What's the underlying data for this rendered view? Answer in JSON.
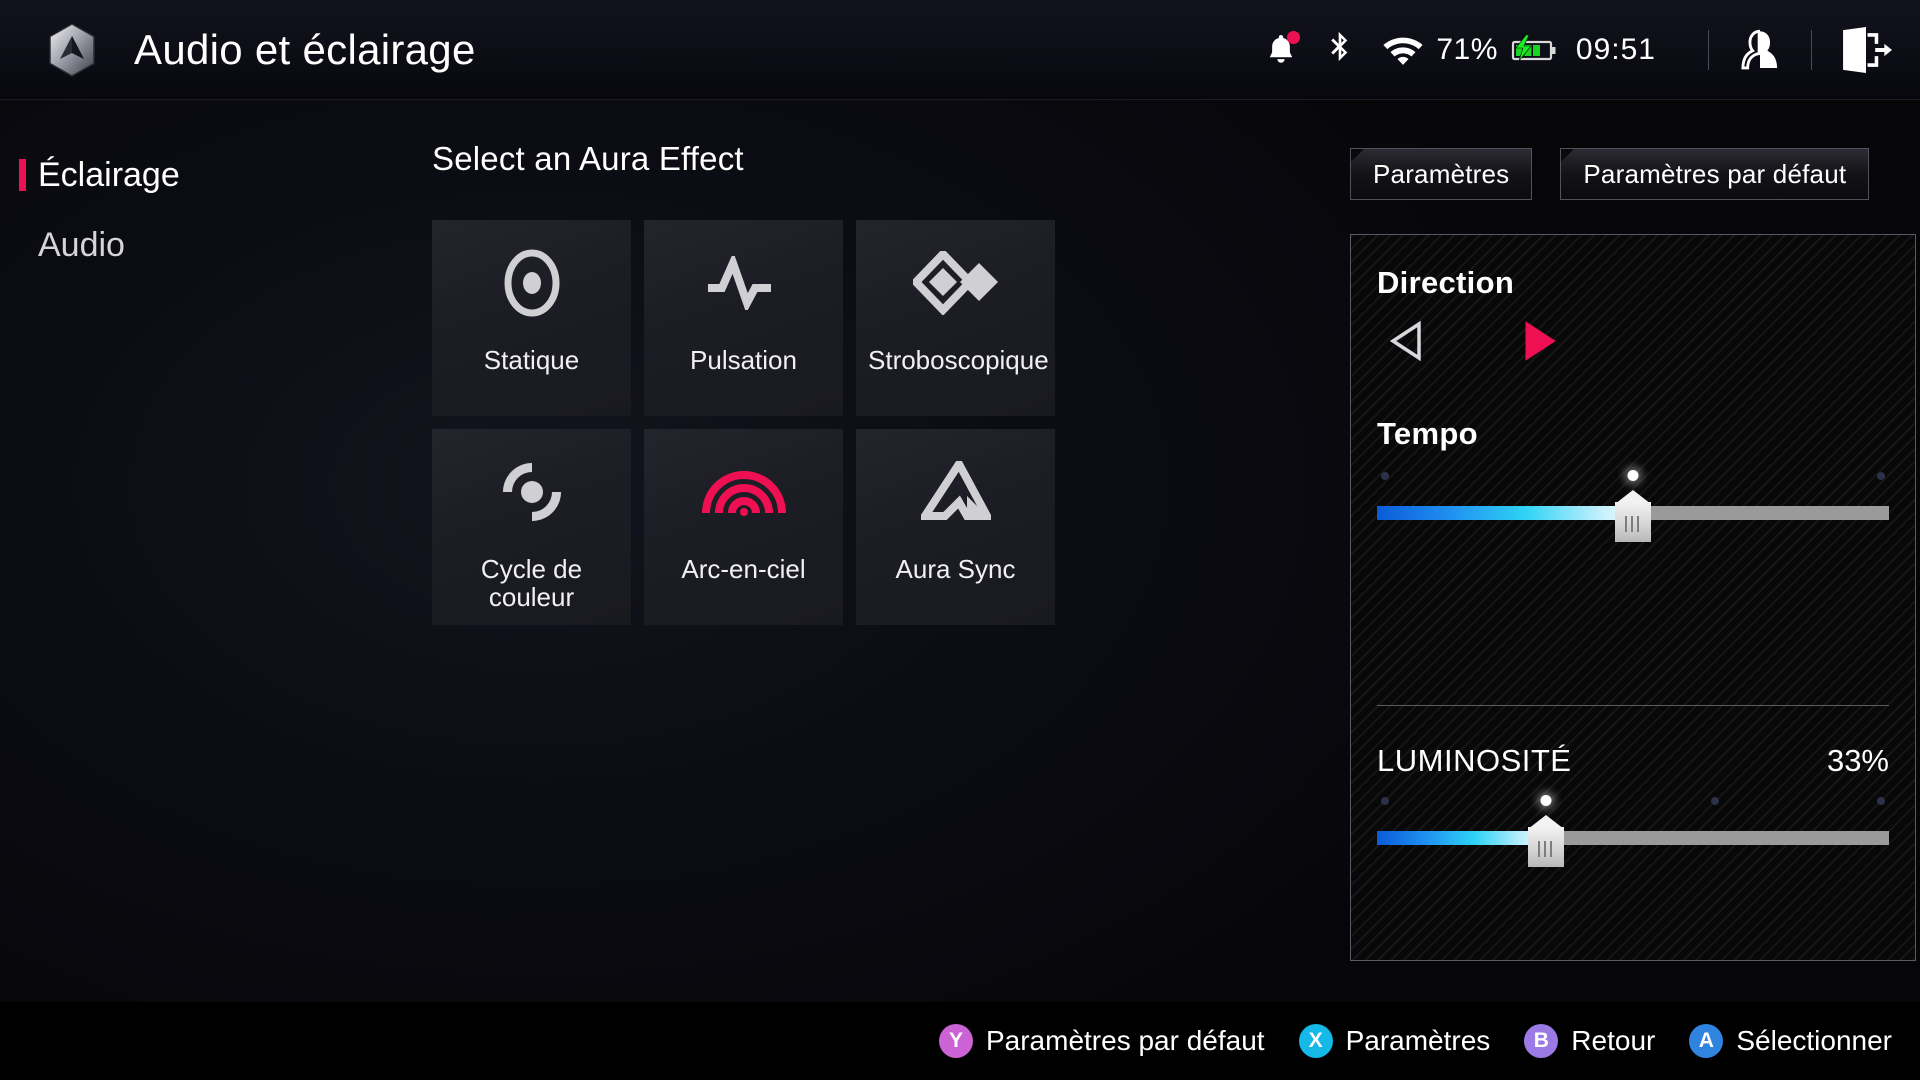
{
  "header": {
    "logo_icon": "asus-rog-hex-logo-icon",
    "title": "Audio et éclairage",
    "status": {
      "notification_icon": "bell-icon",
      "notification_has_badge": true,
      "bluetooth_icon": "bluetooth-icon",
      "wifi_icon": "wifi-icon",
      "battery_percent": "71%",
      "battery_icon": "battery-charging-icon",
      "clock": "09:51",
      "user_icon": "user-profile-icon",
      "exit_icon": "exit-logout-icon"
    }
  },
  "sidebar": {
    "items": [
      {
        "label": "Éclairage",
        "active": true
      },
      {
        "label": "Audio",
        "active": false
      }
    ]
  },
  "main": {
    "section_title": "Select an Aura Effect",
    "effects": [
      {
        "label": "Statique",
        "icon": "static-ring-dot-icon",
        "accent": "#cfcfd4",
        "selected": false
      },
      {
        "label": "Pulsation",
        "icon": "pulse-waveform-icon",
        "accent": "#cfcfd4",
        "selected": false
      },
      {
        "label": "Stroboscopique",
        "icon": "strobe-diamonds-icon",
        "accent": "#cfcfd4",
        "selected": false
      },
      {
        "label": "Cycle de couleur",
        "icon": "color-cycle-icon",
        "accent": "#cfcfd4",
        "selected": false
      },
      {
        "label": "Arc-en-ciel",
        "icon": "rainbow-arcs-icon",
        "accent": "#ef1053",
        "selected": true
      },
      {
        "label": "Aura Sync",
        "icon": "aura-sync-triangle-icon",
        "accent": "#cfcfd4",
        "selected": false
      }
    ]
  },
  "right_panel": {
    "buttons": [
      {
        "label": "Paramètres"
      },
      {
        "label": "Paramètres par défaut"
      }
    ],
    "direction": {
      "title": "Direction",
      "left_arrow_icon": "arrow-left-icon",
      "right_arrow_icon": "arrow-right-icon",
      "left_active": false,
      "right_active": true,
      "active_color": "#ef1053",
      "inactive_color": "#d8d8de"
    },
    "tempo": {
      "title": "Tempo",
      "value_percent": 50,
      "ticks_percent": [
        0,
        50,
        100
      ],
      "active_tick_index": 1
    },
    "brightness": {
      "label": "LUMINOSITÉ",
      "value_text": "33%",
      "value_percent": 33,
      "ticks_percent": [
        0,
        33,
        66,
        100
      ],
      "active_tick_index": 1
    }
  },
  "footer": {
    "hints": [
      {
        "button": "Y",
        "label": "Paramètres par défaut",
        "color": "#cc63d4"
      },
      {
        "button": "X",
        "label": "Paramètres",
        "color": "#14b9e8"
      },
      {
        "button": "B",
        "label": "Retour",
        "color": "#9b7ae6"
      },
      {
        "button": "A",
        "label": "Sélectionner",
        "color": "#2f84e0"
      }
    ]
  }
}
